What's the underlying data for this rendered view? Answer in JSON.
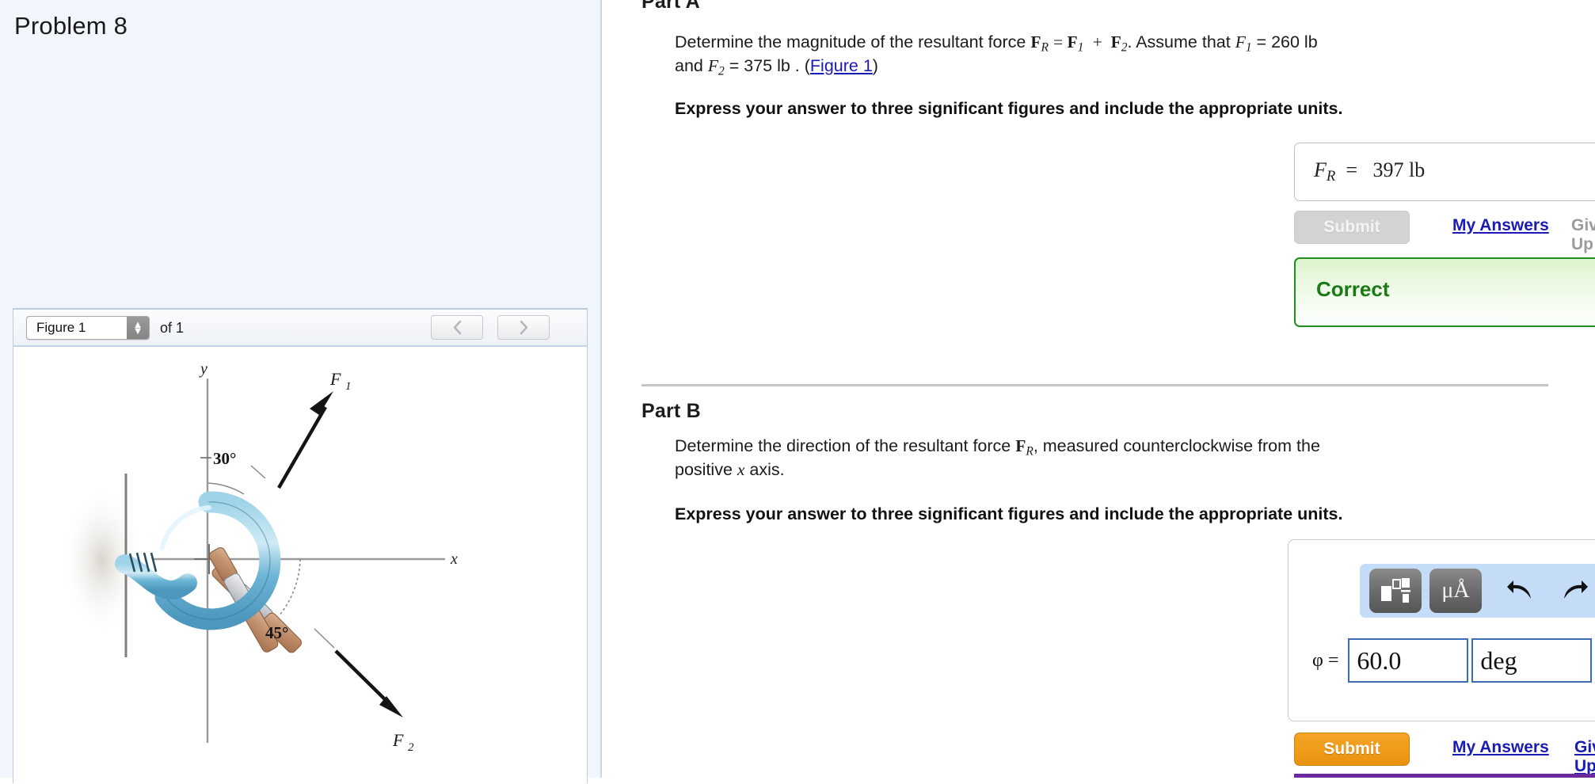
{
  "left_panel": {
    "problem_title": "Problem 8",
    "figure_widget": {
      "selected_figure": "Figure 1",
      "of_label": "of 1",
      "prev_icon": "chevron-left",
      "next_icon": "chevron-right",
      "figure": {
        "axis_y_label": "y",
        "axis_x_label": "x",
        "force1_label": "F1",
        "force2_label": "F2",
        "angle_top": "30°",
        "angle_bottom": "45°",
        "description": "Screw-eye hook anchored in a wall with two turnbuckle rods pulling at F1 and F2"
      }
    }
  },
  "part_a": {
    "heading": "Part A",
    "question_line1_pre": "Determine the magnitude of the resultant force ",
    "question_line1_post": ". Assume that ",
    "f1_value": "= 260 lb",
    "question_line2_pre": "and ",
    "f2_value": "= 375 lb . (",
    "figure_link": "Figure 1",
    "question_line2_post": ")",
    "instruction": "Express your answer to three significant figures and include the appropriate units.",
    "answer_symbol": "FR",
    "answer_value": "397 lb",
    "submit_label": "Submit",
    "my_answers_label": "My Answers",
    "give_up_label": "Give Up",
    "feedback": "Correct",
    "feedback_color": "#1a7a15"
  },
  "part_b": {
    "heading": "Part B",
    "question_line1_pre": "Determine the direction of the resultant force ",
    "question_line1_post": ", measured counterclockwise from the",
    "question_line2_pre": "positive ",
    "question_line2_post": " axis.",
    "instruction": "Express your answer to three significant figures and include the appropriate units.",
    "toolbar": {
      "template_button": "template-icon",
      "units_button": "μÅ",
      "undo_icon": "undo-arrow",
      "redo_icon": "redo-arrow",
      "reset_icon": "reset-circular-arrow",
      "keyboard_icon": "keyboard",
      "help_icon": "?"
    },
    "answer_label": "φ =",
    "answer_value": "60.0",
    "answer_units": "deg",
    "submit_label": "Submit",
    "my_answers_label": "My Answers",
    "give_up_label": "Give Up",
    "submit_color": "#ef9a13"
  }
}
